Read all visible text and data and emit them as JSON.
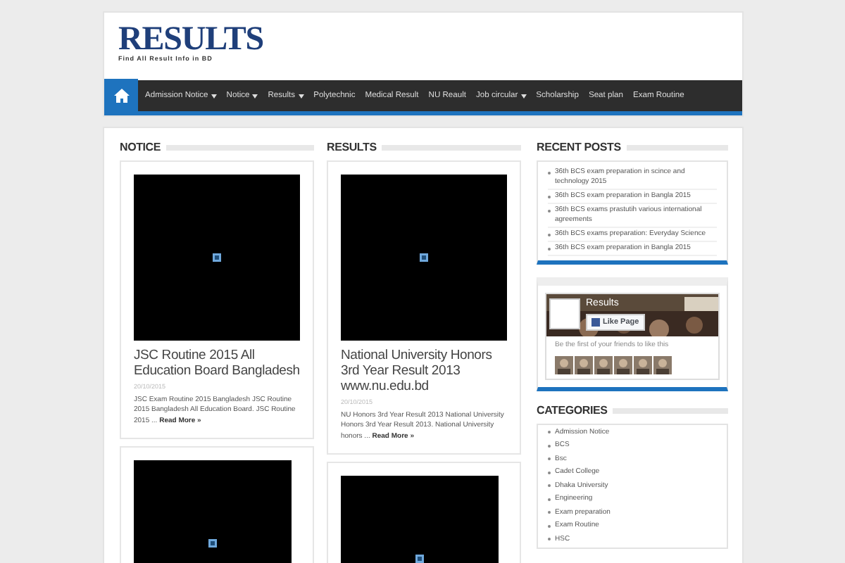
{
  "logo": {
    "title": "RESULTS",
    "tagline": "Find All Result Info in BD"
  },
  "nav": [
    {
      "label": "Admission Notice",
      "dropdown": true
    },
    {
      "label": "Notice",
      "dropdown": true
    },
    {
      "label": "Results",
      "dropdown": true
    },
    {
      "label": "Polytechnic",
      "dropdown": false
    },
    {
      "label": "Medical Result",
      "dropdown": false
    },
    {
      "label": "NU Reault",
      "dropdown": false
    },
    {
      "label": "Job circular",
      "dropdown": true
    },
    {
      "label": "Scholarship",
      "dropdown": false
    },
    {
      "label": "Seat plan",
      "dropdown": false
    },
    {
      "label": "Exam Routine",
      "dropdown": false
    }
  ],
  "columns": [
    {
      "heading": "NOTICE",
      "posts": [
        {
          "title": "JSC Routine 2015 All Education Board Bangladesh",
          "date": "20/10/2015",
          "excerpt": "JSC Exam Routine 2015 Bangladesh JSC Routine 2015 Bangladesh All Education Board. JSC Routine 2015 ...",
          "more": "Read More »"
        },
        {
          "kind": "picture"
        }
      ]
    },
    {
      "heading": "RESULTS",
      "posts": [
        {
          "title": "National University Honors 3rd Year Result 2013 www.nu.edu.bd",
          "date": "20/10/2015",
          "excerpt": "NU Honors 3rd Year Result 2013 National University Honors 3rd Year Result 2013. National University honors ...",
          "more": "Read More »"
        },
        {
          "kind": "picture"
        }
      ]
    }
  ],
  "recent_posts": {
    "heading": "RECENT POSTS",
    "items": [
      "36th BCS exam preparation in scince and technology 2015",
      "36th BCS exam preparation in Bangla 2015",
      "36th BCS exams prastutih various international agreements",
      "36th BCS exams preparation: Everyday Science",
      "36th BCS exam preparation in Bangla 2015"
    ]
  },
  "facebook": {
    "page_name": "Results",
    "like": "Like Page",
    "friends_text": "Be the first of your friends to like this"
  },
  "categories": {
    "heading": "CATEGORIES",
    "items": [
      "Admission Notice",
      "BCS",
      "Bsc",
      "Cadet College",
      "Dhaka University",
      "Engineering",
      "Exam preparation",
      "Exam Routine",
      "HSC"
    ]
  }
}
